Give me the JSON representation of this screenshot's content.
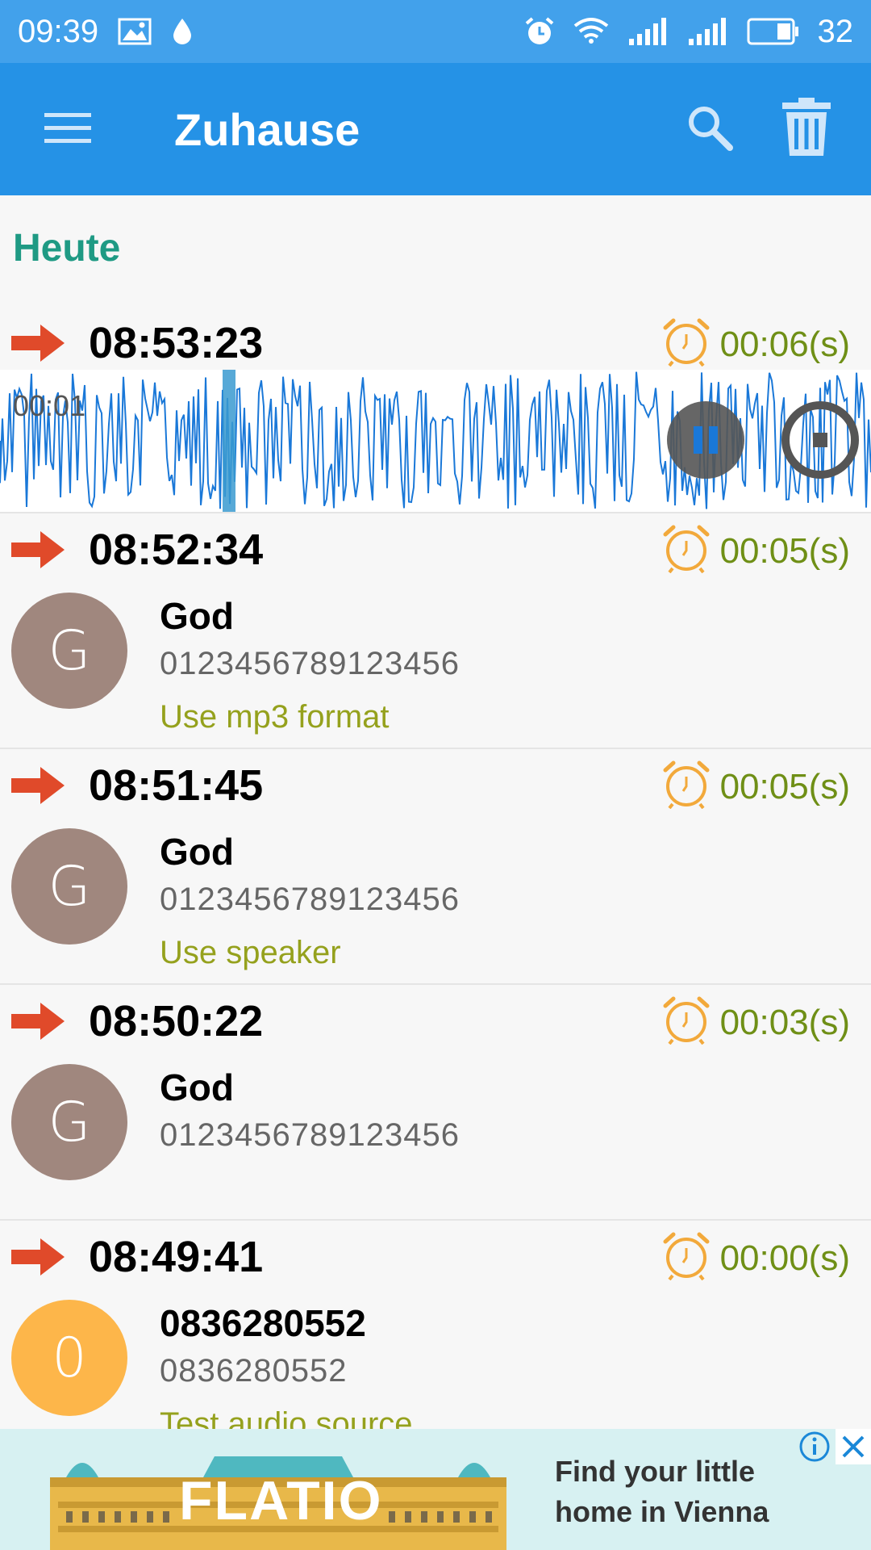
{
  "status_bar": {
    "time": "09:39",
    "battery": "32"
  },
  "app_bar": {
    "title": "Zuhause"
  },
  "section_header": "Heute",
  "playback": {
    "progress_label": "00:01"
  },
  "entries": [
    {
      "time": "08:53:23",
      "duration": "00:06(s)"
    },
    {
      "time": "08:52:34",
      "duration": "00:05(s)",
      "avatar_letter": "G",
      "avatar_color": "#a0877e",
      "name": "God",
      "number": "0123456789123456",
      "note": "Use mp3 format"
    },
    {
      "time": "08:51:45",
      "duration": "00:05(s)",
      "avatar_letter": "G",
      "avatar_color": "#a0877e",
      "name": "God",
      "number": "0123456789123456",
      "note": "Use speaker"
    },
    {
      "time": "08:50:22",
      "duration": "00:03(s)",
      "avatar_letter": "G",
      "avatar_color": "#a0877e",
      "name": "God",
      "number": "0123456789123456",
      "note": ""
    },
    {
      "time": "08:49:41",
      "duration": "00:00(s)",
      "avatar_letter": "0",
      "avatar_color": "#fdb64a",
      "name": "0836280552",
      "number": "0836280552",
      "note": "Test audio source"
    }
  ],
  "ad": {
    "brand": "FLATIO",
    "tagline_line1": "Find your little",
    "tagline_line2": "home in Vienna"
  },
  "colors": {
    "status_bar": "#42a1eb",
    "app_bar": "#2592e6",
    "section": "#1f9a84",
    "duration": "#6f8f16",
    "note": "#95a11d",
    "arrow": "#e04a2a",
    "alarm": "#f2a93b",
    "wave": "#1a78d8"
  }
}
